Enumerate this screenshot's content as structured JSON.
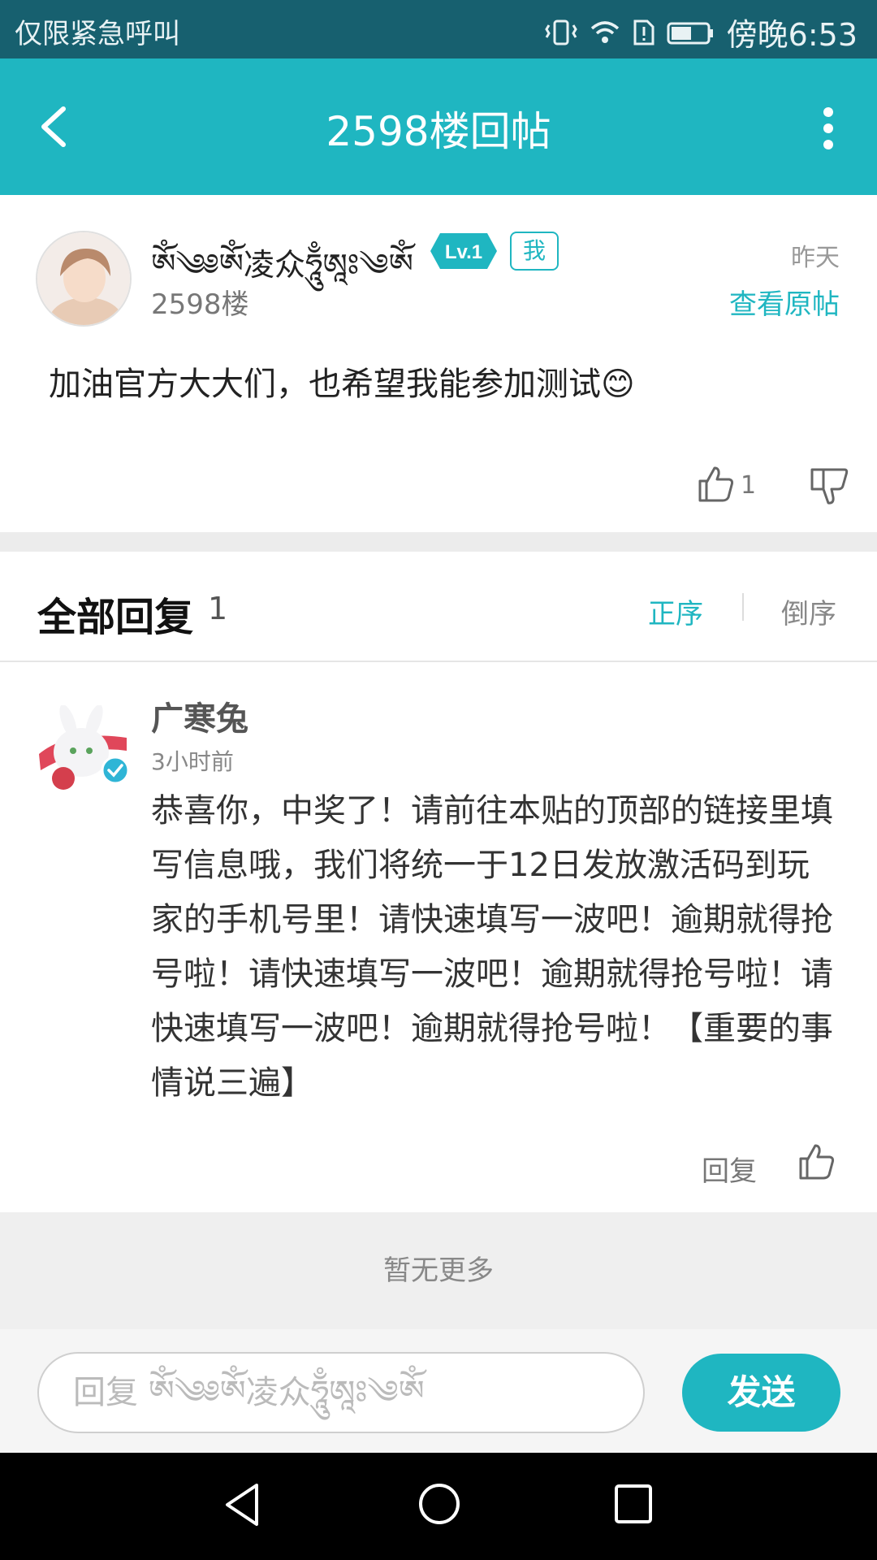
{
  "status_bar": {
    "carrier": "仅限紧急呼叫",
    "time": "傍晚6:53"
  },
  "app_bar": {
    "title": "2598楼回帖"
  },
  "post": {
    "username": "ༀ༄༅ཨོཾ凌众ཧཱུྃཨཱཿ༄ༀ",
    "level": "Lv.1",
    "me_badge": "我",
    "floor": "2598楼",
    "time": "昨天",
    "view_original": "查看原帖",
    "content": "加油官方大大们，也希望我能参加测试😊",
    "like_count": "1"
  },
  "replies_header": {
    "title": "全部回复",
    "count": "1",
    "sort_asc": "正序",
    "sort_desc": "倒序"
  },
  "replies": [
    {
      "username": "广寒兔",
      "time": "3小时前",
      "content": "恭喜你，中奖了！请前往本贴的顶部的链接里填写信息哦，我们将统一于12日发放激活码到玩家的手机号里！请快速填写一波吧！逾期就得抢号啦！请快速填写一波吧！逾期就得抢号啦！请快速填写一波吧！逾期就得抢号啦！【重要的事情说三遍】",
      "reply_label": "回复"
    }
  ],
  "no_more": "暂无更多",
  "input": {
    "placeholder": "回复 ༀ༄༅ཨོཾ凌众ཧཱུྃཨཱཿ༄ༀ",
    "send_label": "发送"
  },
  "colors": {
    "accent": "#1fb6c1",
    "status_bar": "#17606f"
  },
  "icons": [
    "back-arrow-icon",
    "more-vertical-icon",
    "thumb-up-icon",
    "thumb-down-icon",
    "verified-badge-icon",
    "nav-back-icon",
    "nav-home-icon",
    "nav-recents-icon"
  ]
}
